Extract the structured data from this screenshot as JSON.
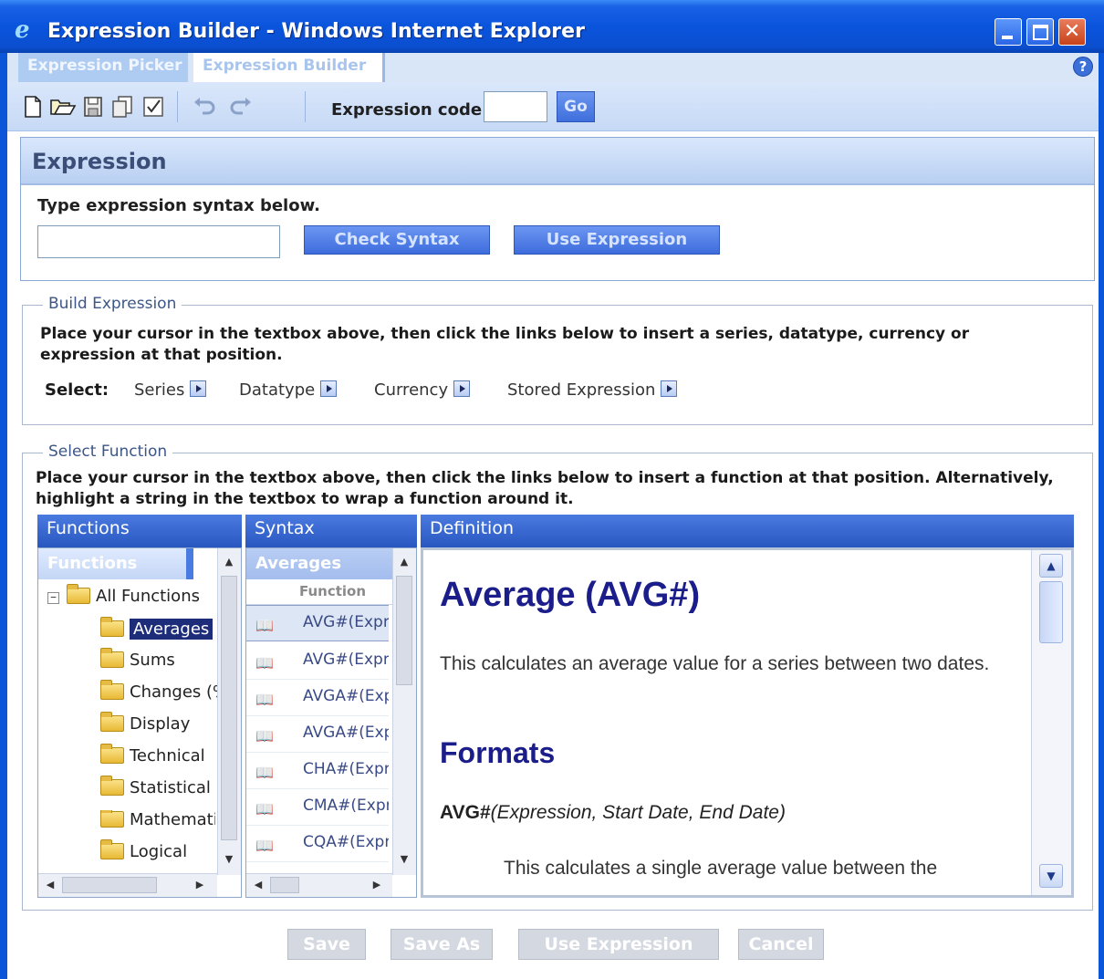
{
  "window": {
    "title": "Expression Builder - Windows Internet Explorer",
    "minimize_icon": "minimize-icon",
    "maximize_icon": "maximize-icon",
    "close_glyph": "✕"
  },
  "tabs": [
    {
      "label": "Expression Picker"
    },
    {
      "label": "Expression Builder"
    }
  ],
  "help_glyph": "?",
  "toolbar": {
    "icons": [
      "new-icon",
      "open-icon",
      "save-icon",
      "copy-icon",
      "check-icon",
      "undo-icon",
      "redo-icon"
    ],
    "expression_code_label": "Expression code",
    "expression_code_value": "",
    "go_label": "Go"
  },
  "expression": {
    "heading": "Expression",
    "instruction": "Type expression syntax below.",
    "input_value": "",
    "check_syntax_label": "Check Syntax",
    "use_expression_label": "Use Expression"
  },
  "build": {
    "legend": "Build Expression",
    "instruction": "Place your cursor in the textbox above, then click the links below to insert a series, datatype, currency or expression at that position.",
    "select_label": "Select:",
    "links": [
      "Series",
      "Datatype",
      "Currency",
      "Stored Expression"
    ]
  },
  "select_function": {
    "legend": "Select Function",
    "instruction": "Place your cursor in the textbox above, then click the links below to insert a function at that position. Alternatively, highlight a string in the textbox to wrap a function around it.",
    "functions_header": "Functions",
    "syntax_header": "Syntax",
    "definition_header": "Definition",
    "functions_subheader": "Functions",
    "tree_root": "All Functions",
    "tree_toggle": "−",
    "tree_items": [
      "Averages",
      "Sums",
      "Changes (%",
      "Display",
      "Technical",
      "Statistical",
      "Mathematical",
      "Logical"
    ],
    "syntax_subheader": "Averages",
    "syntax_column_label": "Function",
    "syntax_rows": [
      "AVG#(Expr",
      "AVG#(Expr",
      "AVGA#(Exp",
      "AVGA#(Exp",
      "CHA#(Expr",
      "CMA#(Expr",
      "CQA#(Expr"
    ],
    "definition": {
      "title": "Average (AVG#)",
      "description": "This calculates an average value for a series between two dates.",
      "formats_heading": "Formats",
      "format_fn": "AVG#",
      "format_args": "(Expression, Start Date, End Date)",
      "format_desc": "This calculates a single average value between the"
    }
  },
  "footer": {
    "save_label": "Save",
    "save_as_label": "Save As",
    "use_expression_label": "Use Expression",
    "cancel_label": "Cancel"
  }
}
